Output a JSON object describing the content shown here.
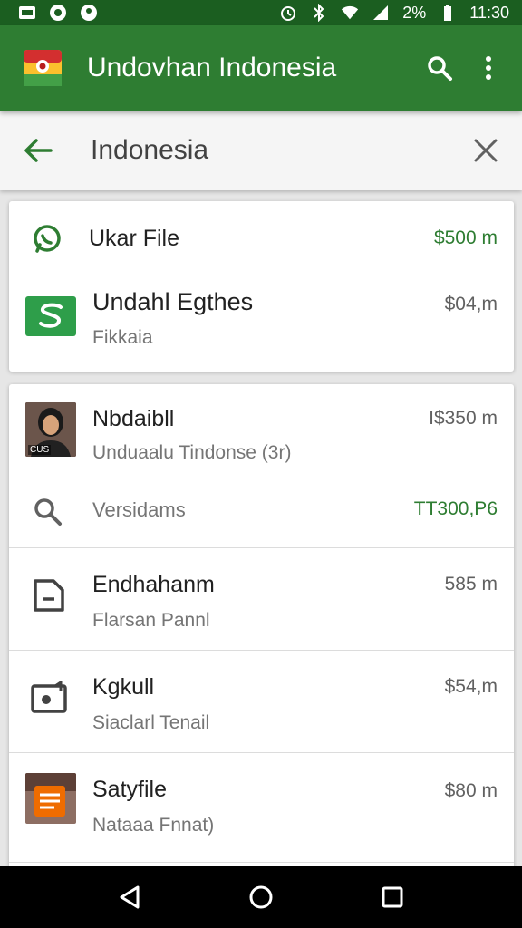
{
  "status_bar": {
    "battery_percent": "2%",
    "time": "11:30"
  },
  "app_bar": {
    "title": "Undovhan Indonesia"
  },
  "search": {
    "query": "Indonesia"
  },
  "card1": [
    {
      "title": "Ukar File",
      "subtitle": "",
      "size": "$500 m",
      "icon": "whatsapp-icon",
      "size_color": "#2e7d32"
    },
    {
      "title": "Undahl Egthes",
      "subtitle": "Fikkaia",
      "size": "$04,m",
      "icon": "green-app-icon",
      "size_color": "#616161"
    }
  ],
  "card2": [
    {
      "title": "Nbdaibll",
      "subtitle": "Unduaalu Tindonse (3r)",
      "size": "I$350 m",
      "icon": "person-photo-thumbnail",
      "thumb_label": "CUS"
    },
    {
      "title": "Versidams",
      "subtitle": "",
      "size": "TT300,P6",
      "icon": "search-icon"
    },
    {
      "title": "Endhahanm",
      "subtitle": "Flarsan Pannl",
      "size": "585 m",
      "icon": "document-icon"
    },
    {
      "title": "Kgkull",
      "subtitle": "Siaclarl Tenail",
      "size": "$54,m",
      "icon": "image-file-icon"
    },
    {
      "title": "Satyfile",
      "subtitle": "Nataaa Fnnat)",
      "size": "$80 m",
      "icon": "notes-app-thumbnail"
    }
  ],
  "colors": {
    "status_bar": "#1b5e20",
    "app_bar": "#2e7d32",
    "accent": "#2e7d32"
  }
}
